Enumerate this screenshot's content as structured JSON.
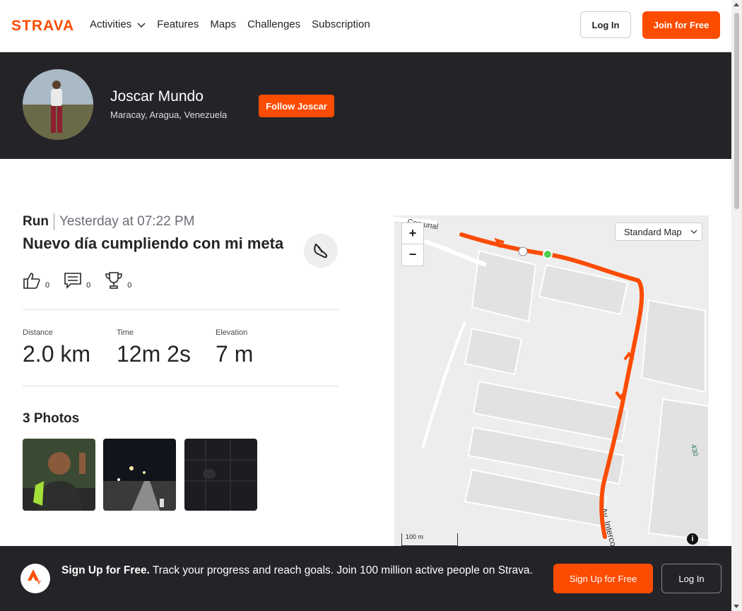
{
  "nav": {
    "logo": "STRAVA",
    "links": [
      "Activities",
      "Features",
      "Maps",
      "Challenges",
      "Subscription"
    ],
    "login_label": "Log In",
    "join_label": "Join for Free"
  },
  "athlete": {
    "name": "Joscar Mundo",
    "location": "Maracay, Aragua, Venezuela",
    "follow_label": "Follow Joscar"
  },
  "activity": {
    "type": "Run",
    "date": "Yesterday at 07:22 PM",
    "title": "Nuevo día cumpliendo con mi meta",
    "kudos": "0",
    "comments": "0",
    "achievements": "0",
    "stats": [
      {
        "label": "Distance",
        "value": "2.0 km"
      },
      {
        "label": "Time",
        "value": "12m 2s"
      },
      {
        "label": "Elevation",
        "value": "7 m"
      }
    ],
    "photos_title": "3 Photos"
  },
  "map": {
    "style_label": "Standard Map",
    "scale_label": "100 m",
    "street_label": "Av. Interco",
    "street_label_2": "Comunal",
    "route_number": "430",
    "route_color": "#fc4c02"
  },
  "footer": {
    "headline": "Sign Up for Free.",
    "text": "Track your progress and reach goals. Join 100 million active people on Strava.",
    "signup_label": "Sign Up for Free",
    "login_label": "Log In"
  },
  "colors": {
    "brand": "#fc4c02",
    "dark": "#242428"
  }
}
